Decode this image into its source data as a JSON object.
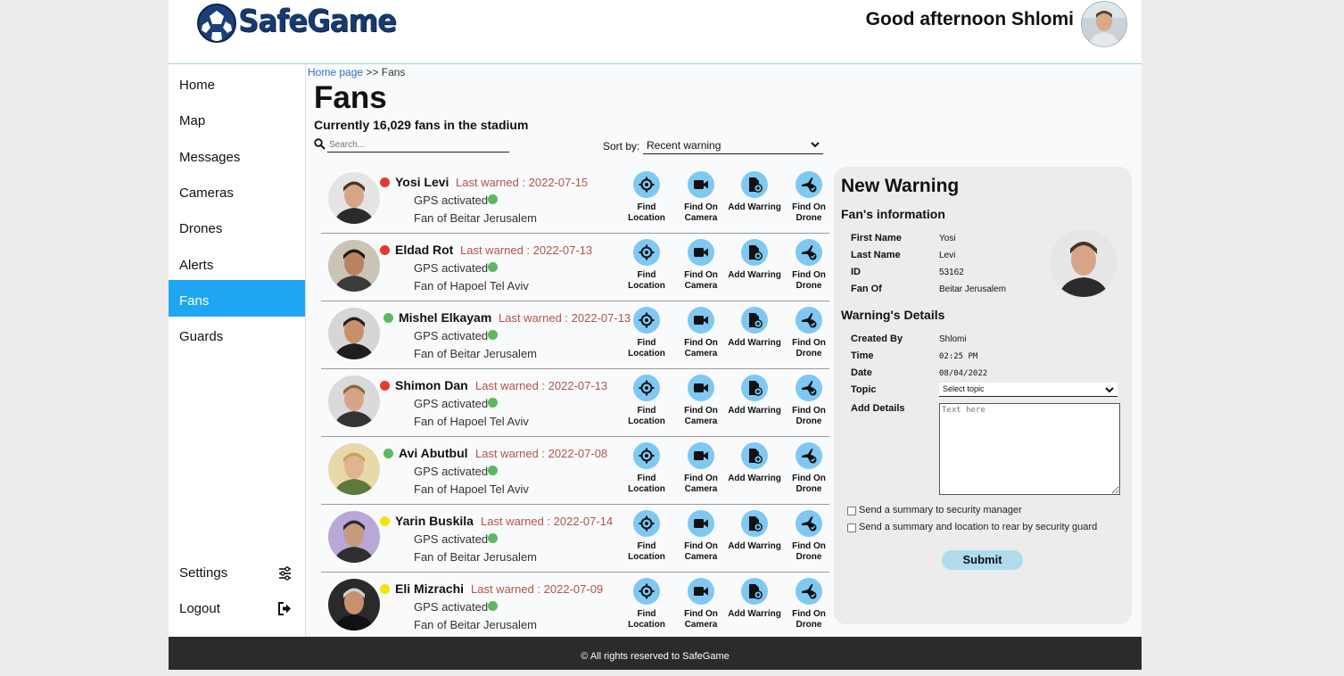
{
  "header": {
    "logo_text": "SafeGame",
    "greeting": "Good afternoon Shlomi"
  },
  "sidebar": {
    "items": [
      {
        "label": "Home"
      },
      {
        "label": "Map"
      },
      {
        "label": "Messages"
      },
      {
        "label": "Cameras"
      },
      {
        "label": "Drones"
      },
      {
        "label": "Alerts"
      },
      {
        "label": "Fans"
      },
      {
        "label": "Guards"
      }
    ],
    "active": "Fans",
    "settings_label": "Settings",
    "logout_label": "Logout",
    "active_color": "#1ea6f2"
  },
  "breadcrumb": {
    "home": "Home page",
    "sep": ">>",
    "current": "Fans"
  },
  "page": {
    "title": "Fans",
    "fan_count": "Currently 16,029 fans in the stadium",
    "search_placeholder": "Search...",
    "sort_label": "Sort by:",
    "sort_value": "Recent warning"
  },
  "actions": {
    "find_location": "Find Location",
    "find_camera": "Find On Camera",
    "add_warning": "Add Warring",
    "find_drone": "Find On Drone"
  },
  "status_colors": {
    "red": "#e53b2c",
    "green": "#5cb85c",
    "yellow": "#f2e600"
  },
  "fans": [
    {
      "name": "Yosi Levi",
      "status": "red",
      "last_warned": "Last warned : 2022-07-15",
      "gps": "GPS activated",
      "team": "Fan of Beitar Jerusalem"
    },
    {
      "name": "Eldad Rot",
      "status": "red",
      "last_warned": "Last warned : 2022-07-13",
      "gps": "GPS activated",
      "team": "Fan of Hapoel Tel Aviv"
    },
    {
      "name": "Mishel Elkayam",
      "status": "green",
      "last_warned": "Last warned : 2022-07-13",
      "gps": "GPS activated",
      "team": "Fan of Beitar Jerusalem"
    },
    {
      "name": "Shimon Dan",
      "status": "red",
      "last_warned": "Last warned : 2022-07-13",
      "gps": "GPS activated",
      "team": "Fan of Hapoel Tel Aviv"
    },
    {
      "name": "Avi Abutbul",
      "status": "green",
      "last_warned": "Last warned : 2022-07-08",
      "gps": "GPS activated",
      "team": "Fan of Hapoel Tel Aviv"
    },
    {
      "name": "Yarin Buskila",
      "status": "yellow",
      "last_warned": "Last warned : 2022-07-14",
      "gps": "GPS activated",
      "team": "Fan of Beitar Jerusalem"
    },
    {
      "name": "Eli Mizrachi",
      "status": "yellow",
      "last_warned": "Last warned : 2022-07-09",
      "gps": "GPS activated",
      "team": "Fan of Beitar Jerusalem"
    }
  ],
  "warning_panel": {
    "title": "New Warning",
    "fan_info_title": "Fan's information",
    "first_name_label": "First Name",
    "first_name": "Yosi",
    "last_name_label": "Last Name",
    "last_name": "Levi",
    "id_label": "ID",
    "id": "53162",
    "fan_of_label": "Fan Of",
    "fan_of": "Beitar Jerusalem",
    "details_title": "Warning's Details",
    "created_by_label": "Created By",
    "created_by": "Shlomi",
    "time_label": "Time",
    "time": "02:25 PM",
    "date_label": "Date",
    "date": "08/04/2022",
    "topic_label": "Topic",
    "topic_placeholder": "Select topic",
    "add_details_label": "Add Details",
    "details_placeholder": "Text here",
    "check1": "Send a summary to security manager",
    "check2": "Send a summary and location to rear by security guard",
    "submit": "Submit"
  },
  "footer": {
    "text": "© All rights reserved to SafeGame"
  }
}
